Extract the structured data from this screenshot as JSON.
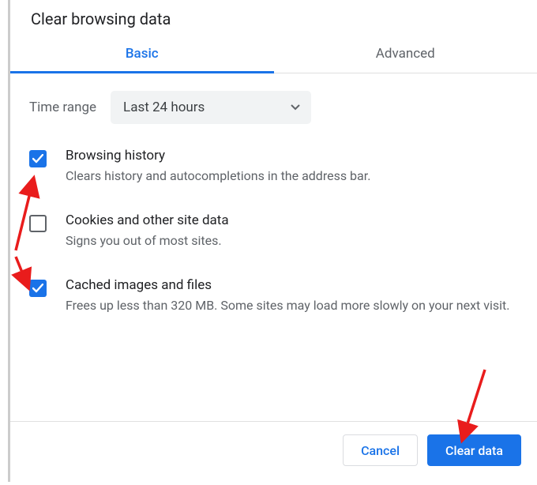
{
  "title": "Clear browsing data",
  "tabs": {
    "basic": "Basic",
    "advanced": "Advanced"
  },
  "time_range": {
    "label": "Time range",
    "selected": "Last 24 hours"
  },
  "options": {
    "browsing_history": {
      "title": "Browsing history",
      "desc": "Clears history and autocompletions in the address bar."
    },
    "cookies": {
      "title": "Cookies and other site data",
      "desc": "Signs you out of most sites."
    },
    "cache": {
      "title": "Cached images and files",
      "desc": "Frees up less than 320 MB. Some sites may load more slowly on your next visit."
    }
  },
  "buttons": {
    "cancel": "Cancel",
    "clear": "Clear data"
  },
  "colors": {
    "primary": "#1a73e8",
    "annotation": "#e91c1c"
  }
}
